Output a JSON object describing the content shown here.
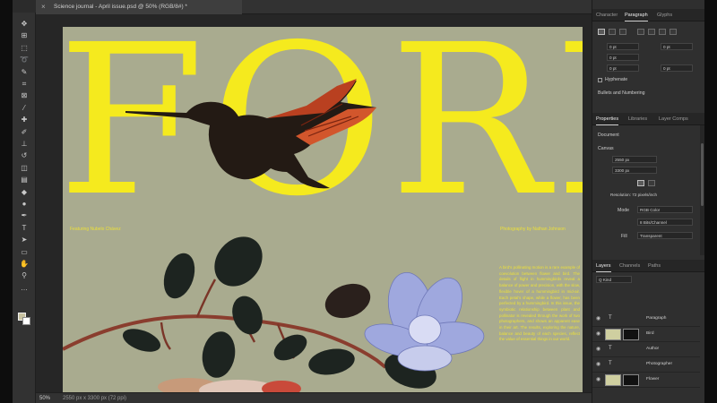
{
  "document": {
    "tab_title": "Science journal - April issue.psd @ 50% (RGB/8#) *",
    "close_glyph": "×"
  },
  "artboard": {
    "headline": "FORM",
    "credit_left": "Featuring Nubelo Chávez",
    "credit_right": "Photography by Nathan Johnson",
    "body_text": "A bird's pollinating motion is a rare example of coevolution between flower and bird. The details of flight in hummingbirds reveal a balance of power and precision, with the slow, flexible hover of a hummingbird in mid-air. Each petal's shape, while a flower, has been perfected by a hummingbird. In this issue, the symbiotic relationship between plant and pollinator is revealed through the work of two photographers, and shows an apparent ease in their art. The results, exploring the nature, balance and beauty of each species, reflect the value of essential things in our world.",
    "colors": {
      "background": "#a9ab8f",
      "accent": "#f5ea1e"
    }
  },
  "status": {
    "zoom": "50%",
    "doc_info": "2550 px x 3300 px (72 ppi)"
  },
  "toolbar": {
    "tools": [
      "move-icon",
      "artboard-icon",
      "marquee-icon",
      "lasso-icon",
      "quick-select-icon",
      "crop-icon",
      "frame-icon",
      "eyedropper-icon",
      "healing-icon",
      "brush-icon",
      "stamp-icon",
      "history-brush-icon",
      "eraser-icon",
      "gradient-icon",
      "blur-icon",
      "dodge-icon",
      "pen-icon",
      "type-icon",
      "path-select-icon",
      "shape-icon",
      "hand-icon",
      "zoom-icon",
      "more-icon"
    ]
  },
  "panels": {
    "character_tabs": [
      "Character",
      "Paragraph",
      "Glyphs"
    ],
    "paragraph": {
      "indent_left": "0 pt",
      "indent_right": "0 pt",
      "first_line": "0 pt",
      "space_after": "0 pt",
      "space_before": "0 pt",
      "hyphenate": "Hyphenate",
      "section": "Bullets and Numbering"
    },
    "properties_tabs": [
      "Properties",
      "Libraries",
      "Layer Comps"
    ],
    "properties": {
      "kind": "Document",
      "section": "Canvas",
      "width": "2550 px",
      "height": "3300 px",
      "orientation_label": "Resolution: 72 pixels/inch",
      "mode_label": "Mode",
      "mode_value": "RGB Color",
      "depth_value": "8 Bits/Channel",
      "fill_label": "Fill",
      "fill_value": "Transparent"
    },
    "layers_tabs": [
      "Layers",
      "Channels",
      "Paths"
    ],
    "layers": {
      "filter": "Q Kind",
      "items": [
        {
          "kind": "T",
          "name": "Paragraph",
          "thumb": false
        },
        {
          "kind": "▣",
          "name": "Bird",
          "thumb": true
        },
        {
          "kind": "T",
          "name": "Author",
          "thumb": false
        },
        {
          "kind": "T",
          "name": "Photographer",
          "thumb": false
        },
        {
          "kind": "▣",
          "name": "Flower",
          "thumb": true
        }
      ]
    }
  }
}
